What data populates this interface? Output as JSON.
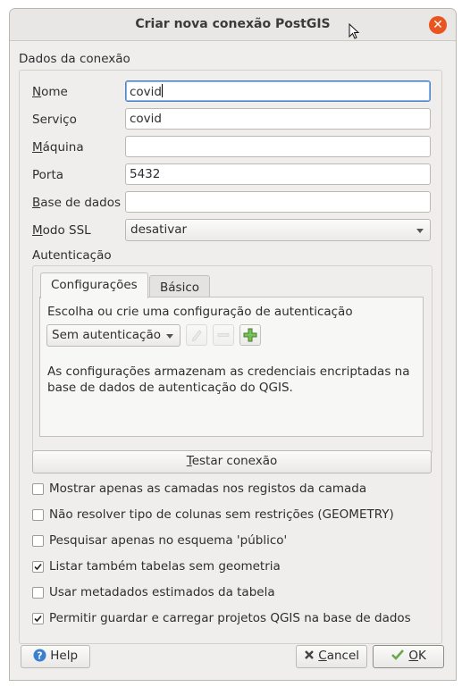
{
  "window": {
    "title": "Criar nova conexão PostGIS"
  },
  "group": {
    "title": "Dados da conexão"
  },
  "fields": {
    "name": {
      "label": "Nome",
      "value": "covid"
    },
    "service": {
      "label": "Serviço",
      "value": "covid"
    },
    "host": {
      "label": "Máquina",
      "value": ""
    },
    "port": {
      "label": "Porta",
      "value": "5432"
    },
    "database": {
      "label": "Base de dados",
      "value": ""
    },
    "ssl_mode": {
      "label": "Modo SSL",
      "value": "desativar"
    }
  },
  "auth": {
    "title": "Autenticação",
    "tabs": [
      "Configurações",
      "Básico"
    ],
    "active_tab": "Configurações",
    "prompt": "Escolha ou crie uma configuração de autenticação",
    "selected": "Sem autenticação",
    "note_line1": "As configurações armazenam as credenciais encriptadas na",
    "note_line2": "base de dados de autenticação do QGIS."
  },
  "test_button": "Testar conexão",
  "options": [
    {
      "label": "Mostrar apenas as camadas nos registos da camada",
      "checked": false
    },
    {
      "label": "Não resolver tipo de colunas sem restrições (GEOMETRY)",
      "checked": false
    },
    {
      "label": "Pesquisar apenas no esquema 'público'",
      "checked": false
    },
    {
      "label": "Listar também tabelas sem geometria",
      "checked": true
    },
    {
      "label": "Usar metadados estimados da tabela",
      "checked": false
    },
    {
      "label": "Permitir guardar e carregar projetos QGIS na base de dados",
      "checked": true
    }
  ],
  "buttons": {
    "help": "Help",
    "cancel": "Cancel",
    "ok": "OK"
  },
  "colors": {
    "accent": "#e95420",
    "focus": "#4f86c6"
  }
}
